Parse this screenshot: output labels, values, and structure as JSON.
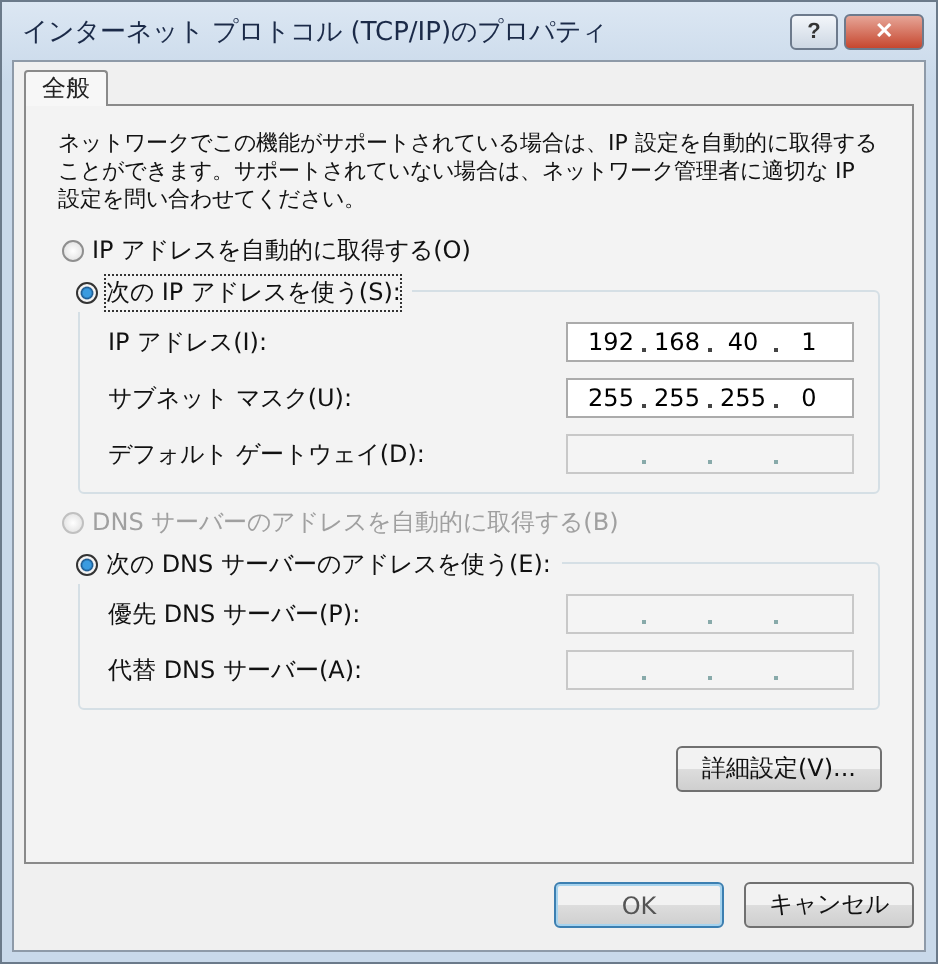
{
  "window": {
    "title": "インターネット プロトコル (TCP/IP)のプロパティ",
    "help_button": "?",
    "close_button": "✕"
  },
  "tabs": [
    {
      "label": "全般",
      "selected": true
    }
  ],
  "description": "ネットワークでこの機能がサポートされている場合は、IP 設定を自動的に取得することができます。サポートされていない場合は、ネットワーク管理者に適切な IP 設定を問い合わせてください。",
  "ip_section": {
    "options": [
      {
        "label": "IP アドレスを自動的に取得する(O)",
        "selected": false,
        "disabled": false
      },
      {
        "label": "次の IP アドレスを使う(S):",
        "selected": true,
        "disabled": false
      }
    ],
    "fields": [
      {
        "label": "IP アドレス(I):",
        "octets": [
          "192",
          "168",
          "40",
          "1"
        ]
      },
      {
        "label": "サブネット マスク(U):",
        "octets": [
          "255",
          "255",
          "255",
          "0"
        ]
      },
      {
        "label": "デフォルト ゲートウェイ(D):"
      }
    ]
  },
  "dns_section": {
    "options": [
      {
        "label": "DNS サーバーのアドレスを自動的に取得する(B)",
        "selected": false,
        "disabled": true
      },
      {
        "label": "次の DNS サーバーのアドレスを使う(E):",
        "selected": true,
        "disabled": false
      }
    ],
    "fields": [
      {
        "label": "優先 DNS サーバー(P):"
      },
      {
        "label": "代替 DNS サーバー(A):"
      }
    ]
  },
  "advanced_button": "詳細設定(V)...",
  "buttons": [
    "OK",
    "キャンセル"
  ]
}
